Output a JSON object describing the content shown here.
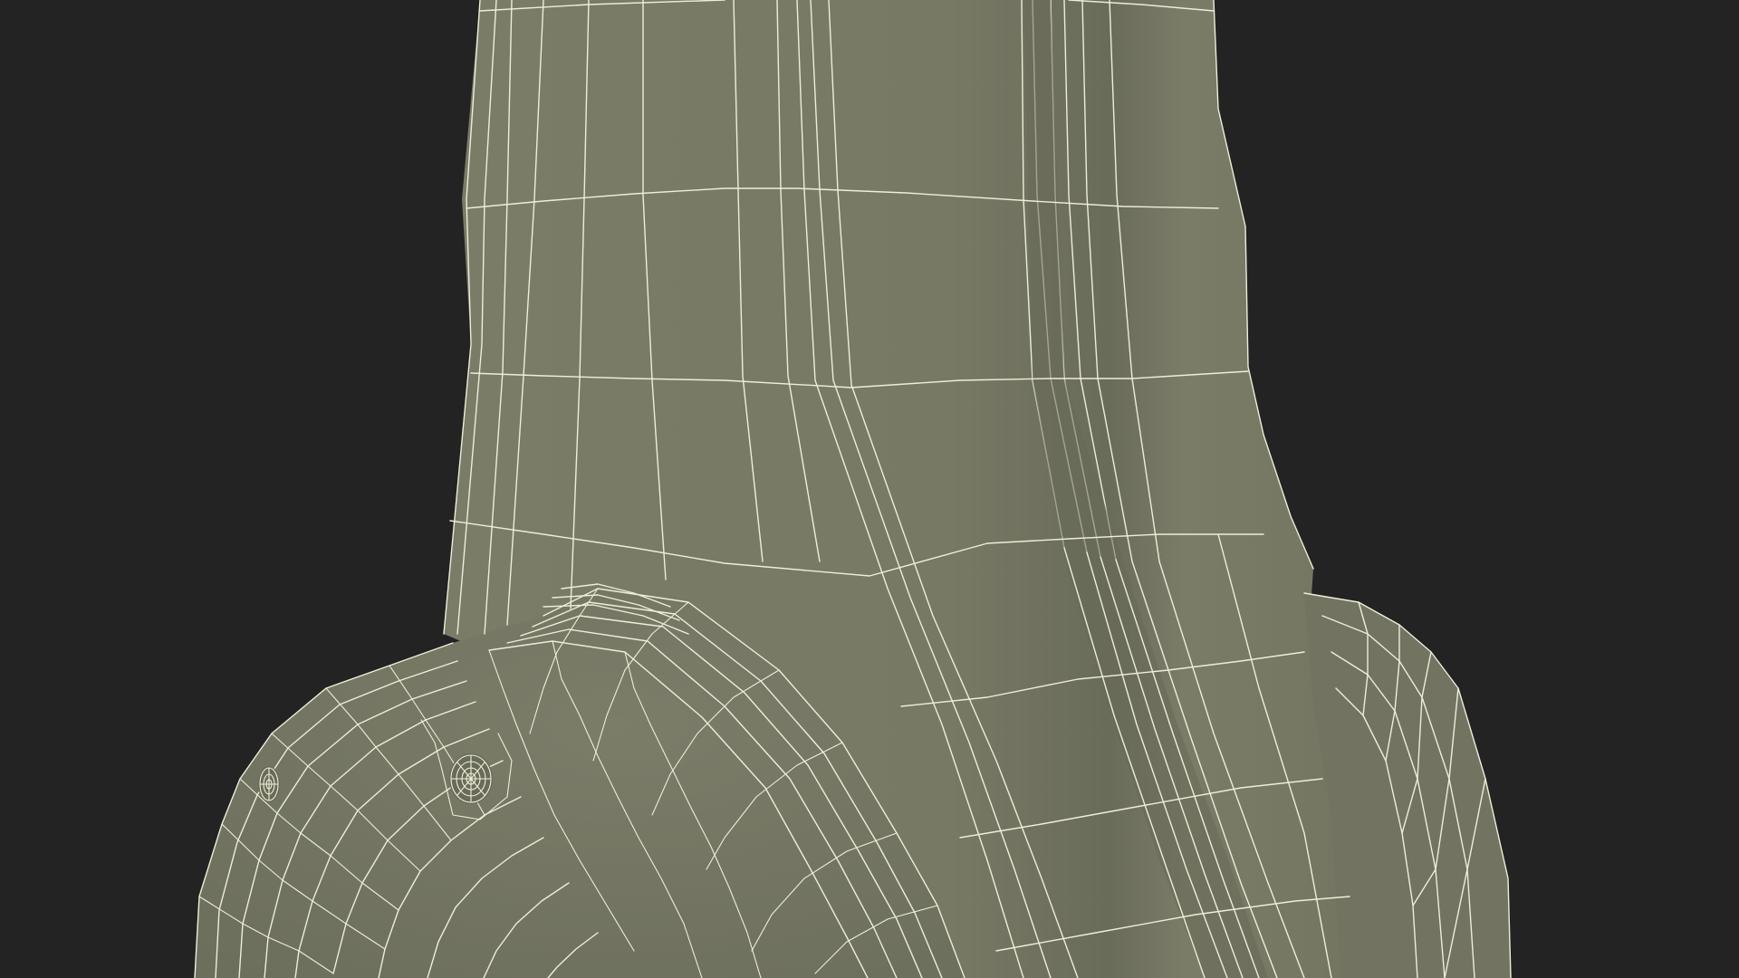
{
  "scene": {
    "background_color": "#232323",
    "surface_color": "#7a7c68",
    "surface_shade_color": "#6c6e5c",
    "surface_dark_color": "#5f614f",
    "wireframe_color": "#eeeed8",
    "subject": "wireframe-mesh"
  }
}
